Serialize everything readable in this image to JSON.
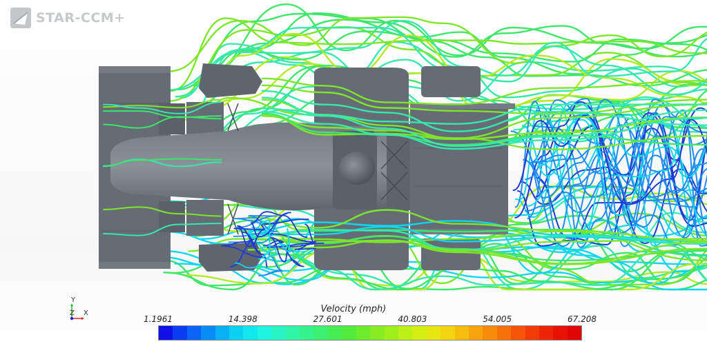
{
  "app": {
    "logo_text": "STAR-CCM+"
  },
  "axes_triad": {
    "y": "Y",
    "z": "Z",
    "x": "X"
  },
  "legend": {
    "title": "Velocity (mph)",
    "ticks": [
      "1.1961",
      "14.398",
      "27.601",
      "40.803",
      "54.005",
      "67.208"
    ],
    "colors": [
      "#1010e8",
      "#0a3cf2",
      "#0a64f6",
      "#0a8cf8",
      "#0ab0f6",
      "#0ad0f2",
      "#10e8ee",
      "#20f4e0",
      "#28f4c4",
      "#30f4a8",
      "#34f28c",
      "#3cf070",
      "#46ee54",
      "#54ec3c",
      "#6aec2c",
      "#86ee22",
      "#a0f01c",
      "#bcf018",
      "#d4ee14",
      "#e8e612",
      "#f2d410",
      "#f6bc0e",
      "#f8a40c",
      "#f88c0a",
      "#f87008",
      "#f65408",
      "#f23c06",
      "#ee2406",
      "#e81204",
      "#e00404"
    ]
  },
  "scene": {
    "body_color": "#656c75",
    "body_dark": "#565d66",
    "streamline_colors": [
      "#1e3ad0",
      "#1e8cf0",
      "#12d6ee",
      "#36e8b0",
      "#3ee66a",
      "#7ee62a",
      "#b4ea22"
    ]
  }
}
